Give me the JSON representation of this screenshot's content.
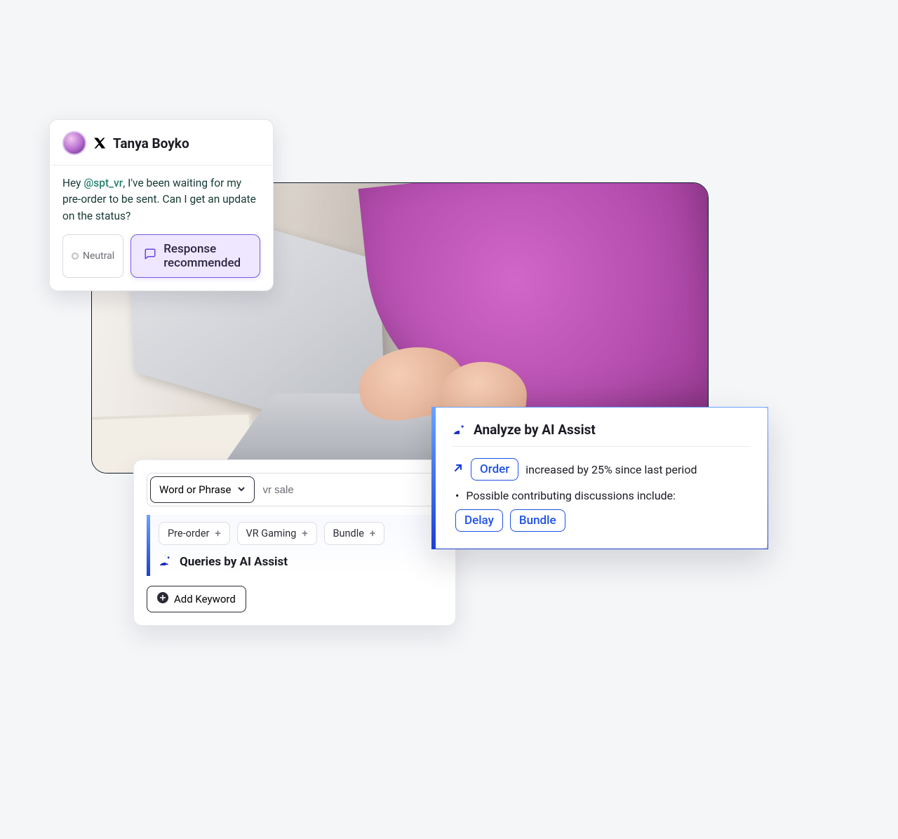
{
  "message": {
    "author": "Tanya Boyko",
    "handle": "@spt_vr",
    "text_before": "Hey ",
    "text_after": ", I've been waiting for my pre-order to be sent. Can I get an update on the status?",
    "sentiment_label": "Neutral",
    "response_label": "Response recommended"
  },
  "queries": {
    "selector_label": "Word or Phrase",
    "input_value": "vr sale",
    "chips": [
      "Pre-order",
      "VR Gaming",
      "Bundle"
    ],
    "title": "Queries by AI Assist",
    "add_keyword_label": "Add Keyword"
  },
  "analyze": {
    "title": "Analyze by AI Assist",
    "topic_chip": "Order",
    "trend_text": "increased by 25% since last period",
    "subheading": "Possible contributing discussions include:",
    "contrib_chips": [
      "Delay",
      "Bundle"
    ]
  }
}
